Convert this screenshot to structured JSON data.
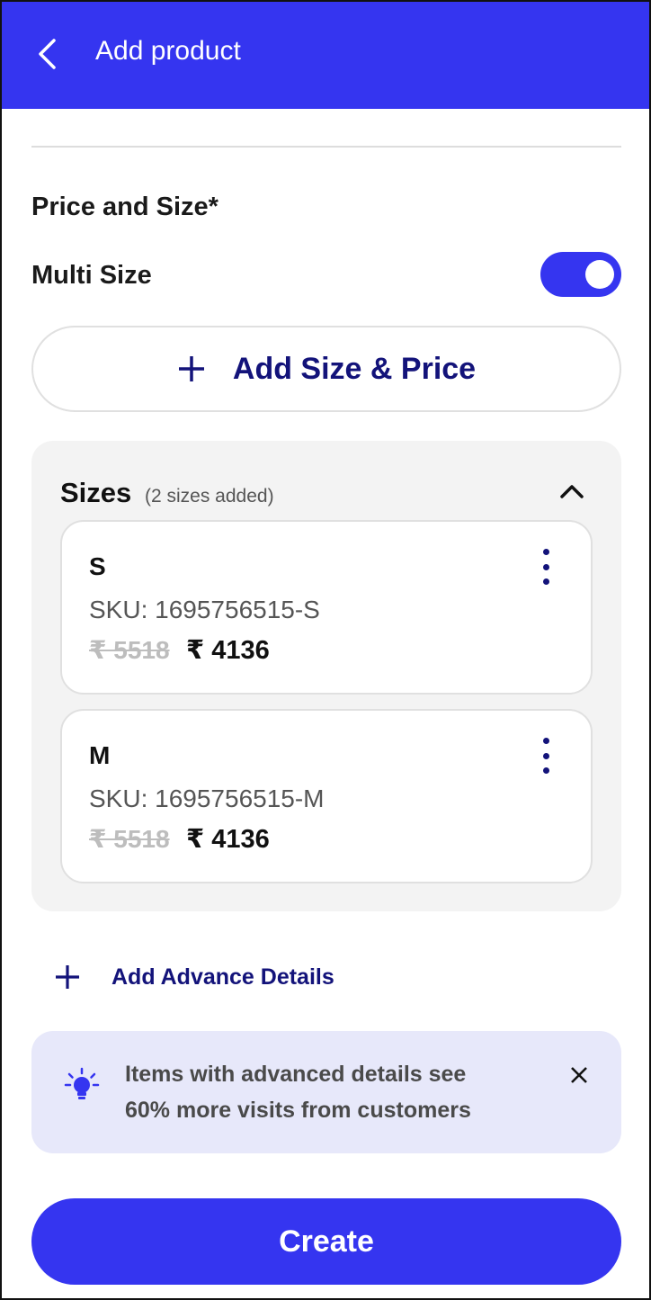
{
  "header": {
    "title": "Add product",
    "back_icon": "chevron-left-icon"
  },
  "price_section": {
    "title": "Price and Size*"
  },
  "multi_size": {
    "label": "Multi Size",
    "enabled": true
  },
  "add_size": {
    "label": "Add Size & Price",
    "icon": "plus-icon"
  },
  "sizes": {
    "title": "Sizes",
    "count_text": "(2 sizes added)",
    "collapse_icon": "chevron-up-icon",
    "items": [
      {
        "name": "S",
        "sku": "SKU: 1695756515-S",
        "old_price": "₹ 5518",
        "new_price": "₹ 4136"
      },
      {
        "name": "M",
        "sku": "SKU: 1695756515-M",
        "old_price": "₹ 5518",
        "new_price": "₹ 4136"
      }
    ]
  },
  "advance": {
    "label": "Add Advance Details",
    "icon": "plus-icon"
  },
  "tip": {
    "line1": "Items with advanced details see",
    "line2": "60% more visits from customers",
    "icon": "lightbulb-icon",
    "close_icon": "close-icon"
  },
  "footer": {
    "create_label": "Create"
  },
  "colors": {
    "accent": "#3535f0",
    "dark_text": "#13137a",
    "tip_bg": "#e7e8fa",
    "panel_bg": "#f3f3f3"
  }
}
